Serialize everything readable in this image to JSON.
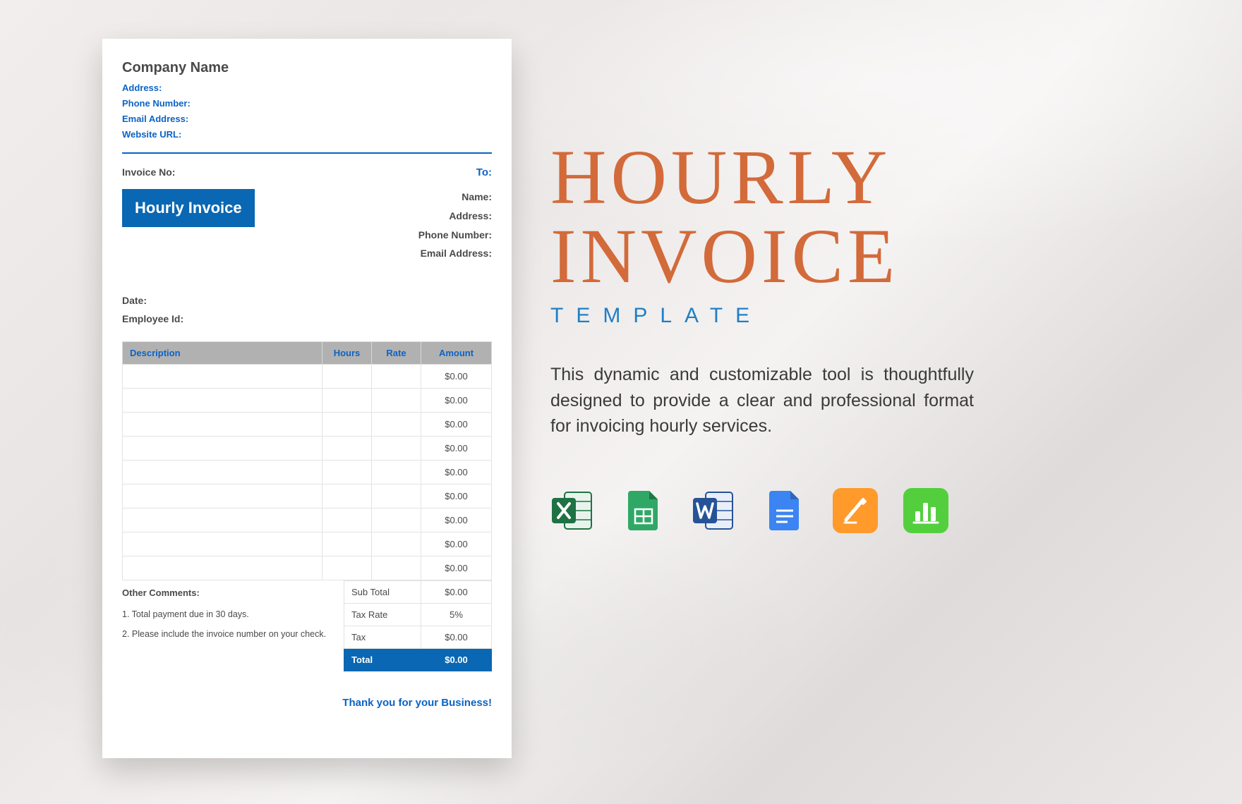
{
  "invoice": {
    "company_name": "Company Name",
    "address_label": "Address:",
    "phone_label": "Phone Number:",
    "email_label": "Email Address:",
    "website_label": "Website URL:",
    "invoice_no_label": "Invoice No:",
    "badge": "Hourly Invoice",
    "to_label": "To:",
    "to_fields": {
      "name": "Name:",
      "address": "Address:",
      "phone": "Phone Number:",
      "email": "Email Address:"
    },
    "date_label": "Date:",
    "employee_id_label": "Employee Id:",
    "columns": {
      "description": "Description",
      "hours": "Hours",
      "rate": "Rate",
      "amount": "Amount"
    },
    "rows": [
      {
        "desc": "",
        "hours": "",
        "rate": "",
        "amount": "$0.00"
      },
      {
        "desc": "",
        "hours": "",
        "rate": "",
        "amount": "$0.00"
      },
      {
        "desc": "",
        "hours": "",
        "rate": "",
        "amount": "$0.00"
      },
      {
        "desc": "",
        "hours": "",
        "rate": "",
        "amount": "$0.00"
      },
      {
        "desc": "",
        "hours": "",
        "rate": "",
        "amount": "$0.00"
      },
      {
        "desc": "",
        "hours": "",
        "rate": "",
        "amount": "$0.00"
      },
      {
        "desc": "",
        "hours": "",
        "rate": "",
        "amount": "$0.00"
      },
      {
        "desc": "",
        "hours": "",
        "rate": "",
        "amount": "$0.00"
      },
      {
        "desc": "",
        "hours": "",
        "rate": "",
        "amount": "$0.00"
      }
    ],
    "comments_title": "Other Comments:",
    "comments": [
      "1. Total payment due in 30 days.",
      "2. Please include the invoice number on your check."
    ],
    "totals": {
      "subtotal_label": "Sub Total",
      "subtotal_value": "$0.00",
      "taxrate_label": "Tax Rate",
      "taxrate_value": "5%",
      "tax_label": "Tax",
      "tax_value": "$0.00",
      "total_label": "Total",
      "total_value": "$0.00"
    },
    "thanks": "Thank you for your Business!"
  },
  "promo": {
    "title_line1": "HOURLY",
    "title_line2": "INVOICE",
    "subtitle": "TEMPLATE",
    "description": "This dynamic and customizable tool is thoughtfully designed to provide a clear and professional format for invoicing hourly services."
  },
  "apps": [
    {
      "name": "excel",
      "color": "#1e7244"
    },
    {
      "name": "sheets",
      "color": "#2fa866"
    },
    {
      "name": "word",
      "color": "#265397"
    },
    {
      "name": "docs",
      "color": "#3b84f2"
    },
    {
      "name": "pages",
      "color": "#ff9a2b"
    },
    {
      "name": "numbers",
      "color": "#53cf3e"
    }
  ]
}
